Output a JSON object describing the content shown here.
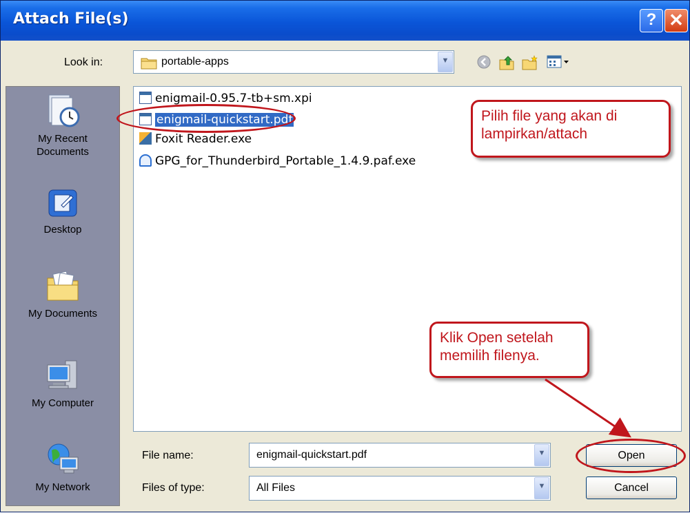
{
  "window": {
    "title": "Attach File(s)",
    "help_glyph": "?",
    "close_glyph": "✕"
  },
  "toolbar": {
    "look_in_label": "Look in:",
    "folder": "portable-apps",
    "back_icon": "back-icon",
    "up_icon": "up-folder-icon",
    "new_folder_icon": "new-folder-icon",
    "view_icon": "views-menu-icon"
  },
  "places": [
    {
      "label": "My Recent\nDocuments",
      "icon": "recent-documents-icon"
    },
    {
      "label": "Desktop",
      "icon": "desktop-icon"
    },
    {
      "label": "My Documents",
      "icon": "my-documents-icon"
    },
    {
      "label": "My Computer",
      "icon": "my-computer-icon"
    },
    {
      "label": "My Network",
      "icon": "my-network-icon"
    }
  ],
  "files": [
    {
      "name": "enigmail-0.95.7-tb+sm.xpi",
      "selected": false
    },
    {
      "name": "enigmail-quickstart.pdf",
      "selected": true
    },
    {
      "name": "Foxit Reader.exe",
      "selected": false
    },
    {
      "name": "GPG_for_Thunderbird_Portable_1.4.9.paf.exe",
      "selected": false
    }
  ],
  "bottom": {
    "file_name_label": "File name:",
    "file_name_value": "enigmail-quickstart.pdf",
    "file_type_label": "Files of type:",
    "file_type_value": "All Files",
    "open_label": "Open",
    "cancel_label": "Cancel"
  },
  "annotations": {
    "select_note": "Pilih file yang akan di lampirkan/attach",
    "open_note": "Klik Open setelah memilih filenya.",
    "color": "#c0161c"
  },
  "colors": {
    "titlebar": "#0a55d8",
    "selection": "#316ac5",
    "places_bg": "#8a8ea5",
    "dialog_bg": "#ece9d8"
  }
}
